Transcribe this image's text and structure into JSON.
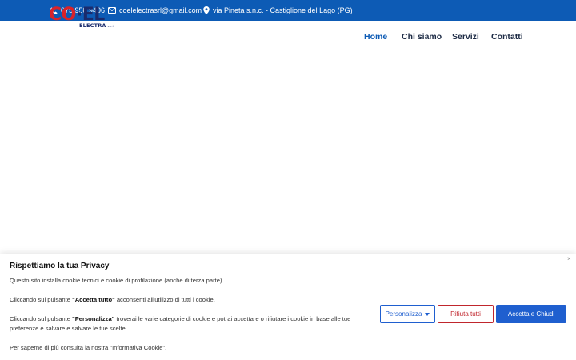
{
  "topbar": {
    "phone": "075 958 9406",
    "email": "coelelectrasrl@gmail.com",
    "address": "via Pineta s.n.c. - Castiglione del Lago (PG)"
  },
  "logo": {
    "main_a": "CO",
    "main_dot": "·",
    "main_b": "EL",
    "sub": "ELECTRA",
    "sub_suffix": "s.r.l."
  },
  "nav": {
    "items": [
      {
        "label": "Home"
      },
      {
        "label": "Chi siamo"
      },
      {
        "label": "Servizi"
      },
      {
        "label": "Contatti"
      }
    ]
  },
  "cookie": {
    "title": "Rispettiamo la tua Privacy",
    "p1": "Questo sito installa cookie tecnici e cookie di profilazione (anche di terza parte)",
    "p2_pre": "Cliccando sul pulsante ",
    "p2_bold": "\"Accetta tutto\"",
    "p2_post": " acconsenti all'utilizzo di tutti i cookie.",
    "p3_pre": "Cliccando sul pulsante ",
    "p3_bold": "\"Personalizza\"",
    "p3_post": " troverai le varie categorie di cookie e potrai accettare o rifiutare i cookie in base alle tue preferenze e salvare e salvare le tue scelte.",
    "p4": "Per saperne di più consulta la nostra \"Informativa Cookie\".",
    "close": "×",
    "btn_customize": "Personalizza",
    "btn_reject": "Rifiuta tutti",
    "btn_accept": "Accetta e Chiudi"
  },
  "colors": {
    "topbar": "#0d5bb5",
    "brand_red": "#d8232a",
    "brand_navy": "#1a2b6d",
    "button_blue": "#1f5fcf",
    "button_red": "#c0262d"
  }
}
